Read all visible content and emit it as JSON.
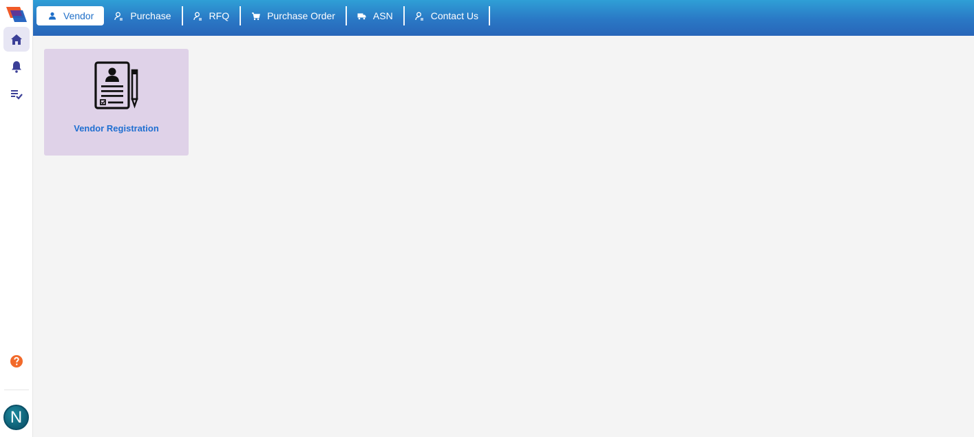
{
  "nav": {
    "tabs": [
      {
        "label": "Vendor",
        "icon": "person-icon",
        "active": true
      },
      {
        "label": "Purchase",
        "icon": "person-outline-icon",
        "active": false
      },
      {
        "label": "RFQ",
        "icon": "person-outline-icon",
        "active": false
      },
      {
        "label": "Purchase Order",
        "icon": "cart-icon",
        "active": false
      },
      {
        "label": "ASN",
        "icon": "truck-icon",
        "active": false
      },
      {
        "label": "Contact Us",
        "icon": "person-outline-icon",
        "active": false
      }
    ]
  },
  "sidebar": {
    "items": [
      {
        "icon": "home-icon",
        "active": true
      },
      {
        "icon": "bell-icon",
        "active": false
      },
      {
        "icon": "task-list-icon",
        "active": false
      }
    ],
    "help_icon": "help-icon",
    "avatar_initial": "N"
  },
  "main": {
    "cards": [
      {
        "label": "Vendor Registration",
        "icon": "registration-form-icon"
      }
    ]
  },
  "colors": {
    "topbar_start": "#2f9fd6",
    "topbar_end": "#2865b8",
    "card_bg": "#dfd2e8",
    "card_label": "#1f6fd1",
    "sidebar_accent": "#3b3f97",
    "help": "#f26a2a"
  }
}
